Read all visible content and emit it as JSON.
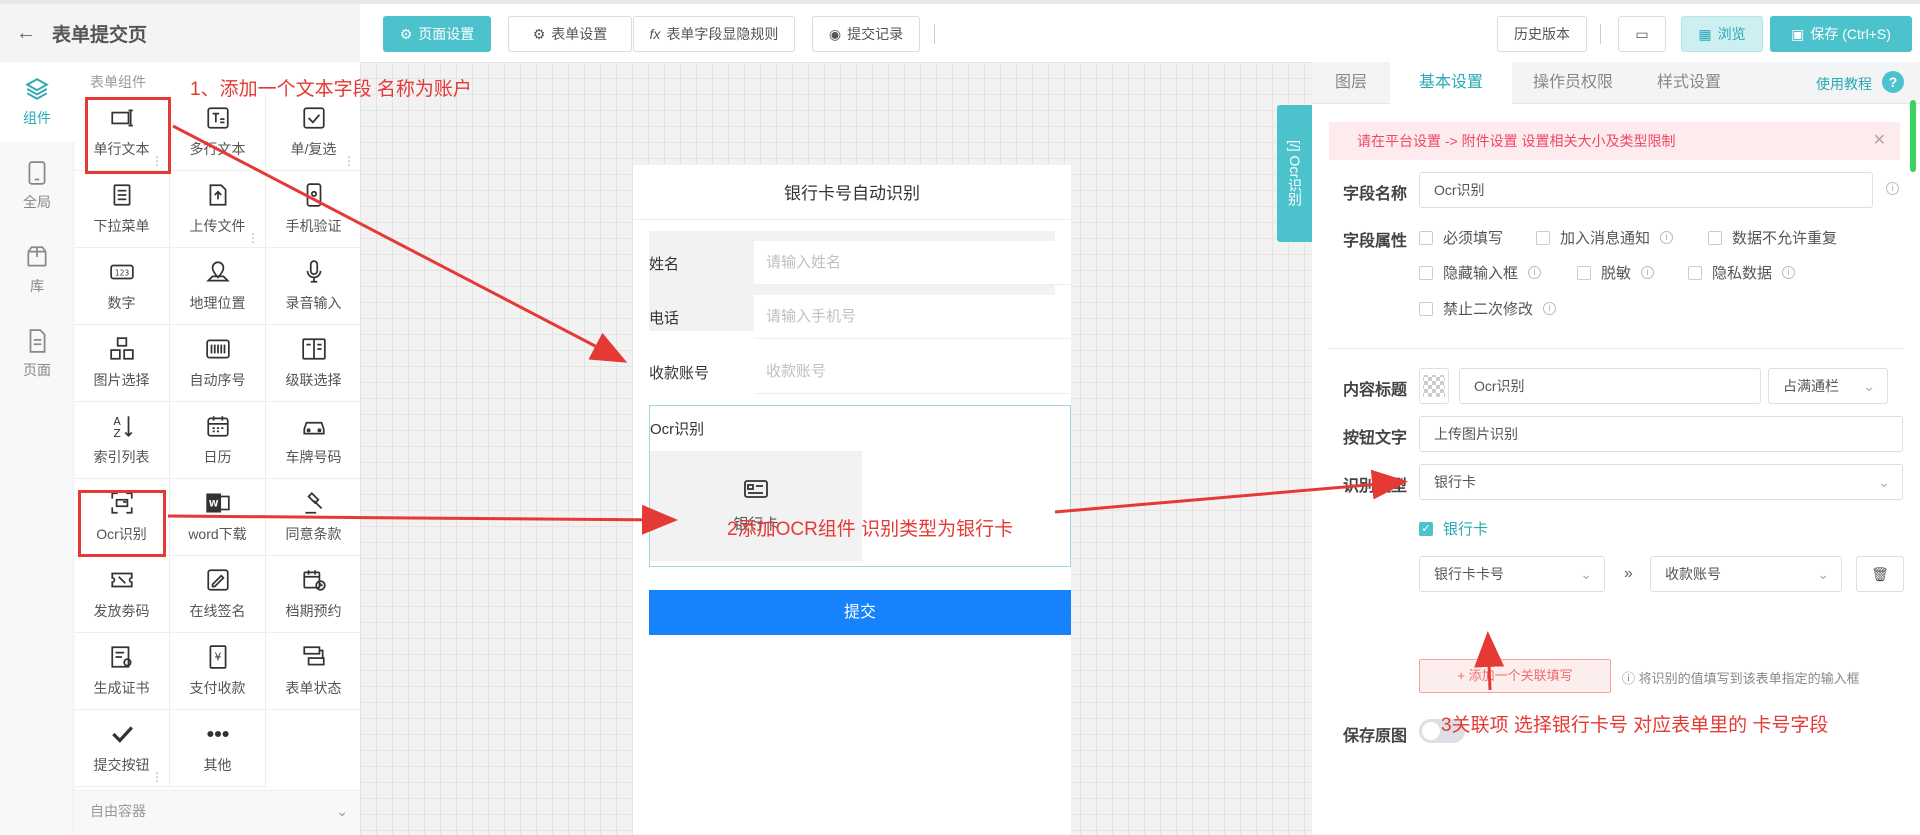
{
  "header": {
    "back_icon": "arrow-left-icon",
    "title": "表单提交页",
    "buttons": {
      "page_settings": "页面设置",
      "form_settings": "表单设置",
      "field_rules": "表单字段显隐规则",
      "submit_records": "提交记录",
      "history": "历史版本",
      "preview": "浏览",
      "save": "保存 (Ctrl+S)"
    },
    "colors": {
      "accent": "#4cc3cc",
      "accent_light": "#cdeff1"
    }
  },
  "nav": {
    "items": [
      {
        "label": "组件",
        "icon": "layers-icon",
        "active": true
      },
      {
        "label": "全局",
        "icon": "tablet-icon",
        "active": false
      },
      {
        "label": "库",
        "icon": "package-icon",
        "active": false
      },
      {
        "label": "页面",
        "icon": "document-icon",
        "active": false
      }
    ]
  },
  "components": {
    "group_title": "表单组件",
    "items": [
      {
        "label": "单行文本",
        "icon": "single-line-text-icon"
      },
      {
        "label": "多行文本",
        "icon": "multi-line-text-icon"
      },
      {
        "label": "单/复选",
        "icon": "checkbox-icon"
      },
      {
        "label": "下拉菜单",
        "icon": "dropdown-list-icon"
      },
      {
        "label": "上传文件",
        "icon": "upload-file-icon"
      },
      {
        "label": "手机验证",
        "icon": "phone-verify-icon"
      },
      {
        "label": "数字",
        "icon": "number-icon"
      },
      {
        "label": "地理位置",
        "icon": "location-icon"
      },
      {
        "label": "录音输入",
        "icon": "microphone-icon"
      },
      {
        "label": "图片选择",
        "icon": "image-grid-icon"
      },
      {
        "label": "自动序号",
        "icon": "barcode-icon"
      },
      {
        "label": "级联选择",
        "icon": "cascade-icon"
      },
      {
        "label": "索引列表",
        "icon": "sort-az-icon"
      },
      {
        "label": "日历",
        "icon": "calendar-icon"
      },
      {
        "label": "车牌号码",
        "icon": "car-icon"
      },
      {
        "label": "Ocr识别",
        "icon": "ocr-scan-icon"
      },
      {
        "label": "word下载",
        "icon": "word-icon"
      },
      {
        "label": "同意条款",
        "icon": "gavel-icon"
      },
      {
        "label": "发放劵码",
        "icon": "coupon-icon"
      },
      {
        "label": "在线签名",
        "icon": "signature-icon"
      },
      {
        "label": "档期预约",
        "icon": "schedule-icon"
      },
      {
        "label": "生成证书",
        "icon": "certificate-icon"
      },
      {
        "label": "支付收款",
        "icon": "payment-icon"
      },
      {
        "label": "表单状态",
        "icon": "form-status-icon"
      },
      {
        "label": "提交按钮",
        "icon": "check-icon"
      },
      {
        "label": "其他",
        "icon": "more-dots-icon"
      }
    ],
    "free_container": "自由容器"
  },
  "phone": {
    "title": "银行卡号自动识别",
    "fields": [
      {
        "label": "姓名",
        "placeholder": "请输入姓名"
      },
      {
        "label": "电话",
        "placeholder": "请输入手机号"
      },
      {
        "label": "收款账号",
        "placeholder": "收款账号"
      }
    ],
    "ocr": {
      "label": "Ocr识别",
      "button_label": "银行卡",
      "icon": "id-card-icon"
    },
    "submit": "提交",
    "submit_color": "#1682fb"
  },
  "side_tab": "[/] Ocr识别",
  "right_panel": {
    "tabs": [
      "图层",
      "基本设置",
      "操作员权限",
      "样式设置"
    ],
    "active_tab": "基本设置",
    "help": "使用教程",
    "notice": "请在平台设置 -> 附件设置 设置相关大小及类型限制",
    "field_name_label": "字段名称",
    "field_name_value": "Ocr识别",
    "field_attr_label": "字段属性",
    "attributes": [
      "必须填写",
      "加入消息通知",
      "数据不允许重复",
      "隐藏输入框",
      "脱敏",
      "隐私数据",
      "禁止二次修改"
    ],
    "content_title_label": "内容标题",
    "content_title_value": "Ocr识别",
    "content_title_width": "占满通栏",
    "button_text_label": "按钮文字",
    "button_text_value": "上传图片识别",
    "recog_type_label": "识别类型",
    "recog_type_value": "银行卡",
    "recog_checked": "银行卡",
    "mapping_source": "银行卡卡号",
    "mapping_target": "收款账号",
    "add_link": "+ 添加一个关联填写",
    "hint": "ⓘ 将识别的值填写到该表单指定的输入框",
    "save_original_label": "保存原图",
    "save_original_on": false
  },
  "annotations": {
    "a1": "1、添加一个文本字段 名称为账户",
    "a2": "2添加OCR组件 识别类型为银行卡",
    "a3": "3关联项 选择银行卡号 对应表单里的 卡号字段",
    "color": "#e53935"
  }
}
